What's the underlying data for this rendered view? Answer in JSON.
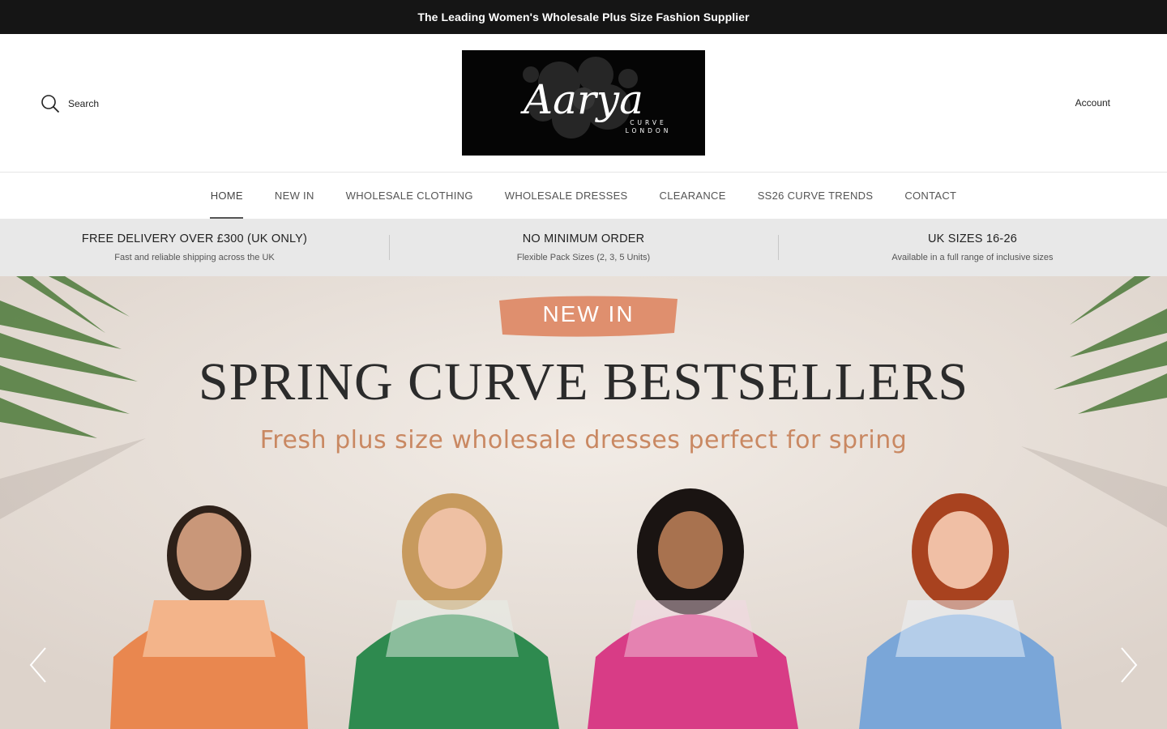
{
  "announcement": "The Leading Women's Wholesale Plus Size Fashion Supplier",
  "header": {
    "search_label": "Search",
    "account_label": "Account",
    "logo": {
      "script": "Aarya",
      "line1": "CURVE",
      "line2": "LONDON"
    }
  },
  "nav": {
    "items": [
      {
        "label": "HOME"
      },
      {
        "label": "NEW IN"
      },
      {
        "label": "WHOLESALE CLOTHING"
      },
      {
        "label": "WHOLESALE DRESSES"
      },
      {
        "label": "CLEARANCE"
      },
      {
        "label": "SS26 CURVE TRENDS"
      },
      {
        "label": "CONTACT"
      }
    ],
    "active": "HOME"
  },
  "usp": [
    {
      "title": "FREE DELIVERY OVER £300 (UK ONLY)",
      "sub": "Fast and reliable shipping across the UK"
    },
    {
      "title": "NO MINIMUM ORDER",
      "sub": "Flexible Pack Sizes (2, 3, 5 Units)"
    },
    {
      "title": "UK SIZES 16-26",
      "sub": "Available in a full range of inclusive sizes"
    }
  ],
  "hero": {
    "badge": "NEW IN",
    "title": "SPRING CURVE BESTSELLERS",
    "subtitle": "Fresh plus size wholesale dresses perfect for spring",
    "badge_color": "#df8f6e",
    "dress_colors": [
      "#e9874f",
      "#2e8a4f",
      "#d83c86",
      "#7aa6d8"
    ]
  }
}
